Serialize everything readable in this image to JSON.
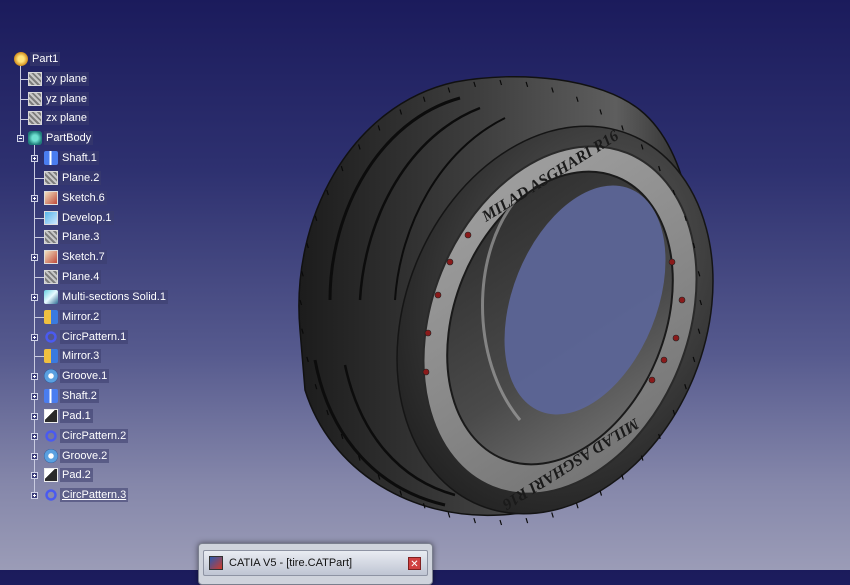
{
  "tree": {
    "root": {
      "label": "Part1",
      "icon": "part-icon"
    },
    "planes": [
      {
        "label": "xy plane",
        "icon": "plane-icon"
      },
      {
        "label": "yz plane",
        "icon": "plane-icon"
      },
      {
        "label": "zx plane",
        "icon": "plane-icon"
      }
    ],
    "body": {
      "label": "PartBody",
      "icon": "body-icon"
    },
    "features": [
      {
        "label": "Shaft.1",
        "icon": "shaft-icon",
        "expandable": true
      },
      {
        "label": "Plane.2",
        "icon": "plane-icon",
        "expandable": false
      },
      {
        "label": "Sketch.6",
        "icon": "sketch-icon",
        "expandable": true
      },
      {
        "label": "Develop.1",
        "icon": "develop-icon",
        "expandable": false
      },
      {
        "label": "Plane.3",
        "icon": "plane-icon",
        "expandable": false
      },
      {
        "label": "Sketch.7",
        "icon": "sketch-icon",
        "expandable": true
      },
      {
        "label": "Plane.4",
        "icon": "plane-icon",
        "expandable": false
      },
      {
        "label": "Multi-sections Solid.1",
        "icon": "multi-section-solid-icon",
        "expandable": true
      },
      {
        "label": "Mirror.2",
        "icon": "mirror-icon",
        "expandable": false
      },
      {
        "label": "CircPattern.1",
        "icon": "circular-pattern-icon",
        "expandable": true
      },
      {
        "label": "Mirror.3",
        "icon": "mirror-icon",
        "expandable": false
      },
      {
        "label": "Groove.1",
        "icon": "groove-icon",
        "expandable": true
      },
      {
        "label": "Shaft.2",
        "icon": "shaft-icon",
        "expandable": true
      },
      {
        "label": "Pad.1",
        "icon": "pad-icon",
        "expandable": true
      },
      {
        "label": "CircPattern.2",
        "icon": "circular-pattern-icon",
        "expandable": true
      },
      {
        "label": "Groove.2",
        "icon": "groove-icon",
        "expandable": true
      },
      {
        "label": "Pad.2",
        "icon": "pad-icon",
        "expandable": true
      },
      {
        "label": "CircPattern.3",
        "icon": "circular-pattern-icon",
        "expandable": true
      }
    ]
  },
  "model": {
    "sidewall_text_top": "MILAD ASGHARI R16",
    "sidewall_text_bottom": "MILAD ASGHARI R16",
    "colors": {
      "tire": "#3a3a3a",
      "sidewall_band": "#8f8f8f",
      "accent": "#8a1a1a"
    }
  },
  "taskbar": {
    "window_title": "CATIA V5 - [tire.CATPart]",
    "app_icon": "catia-app-icon",
    "close_icon": "close-icon"
  }
}
